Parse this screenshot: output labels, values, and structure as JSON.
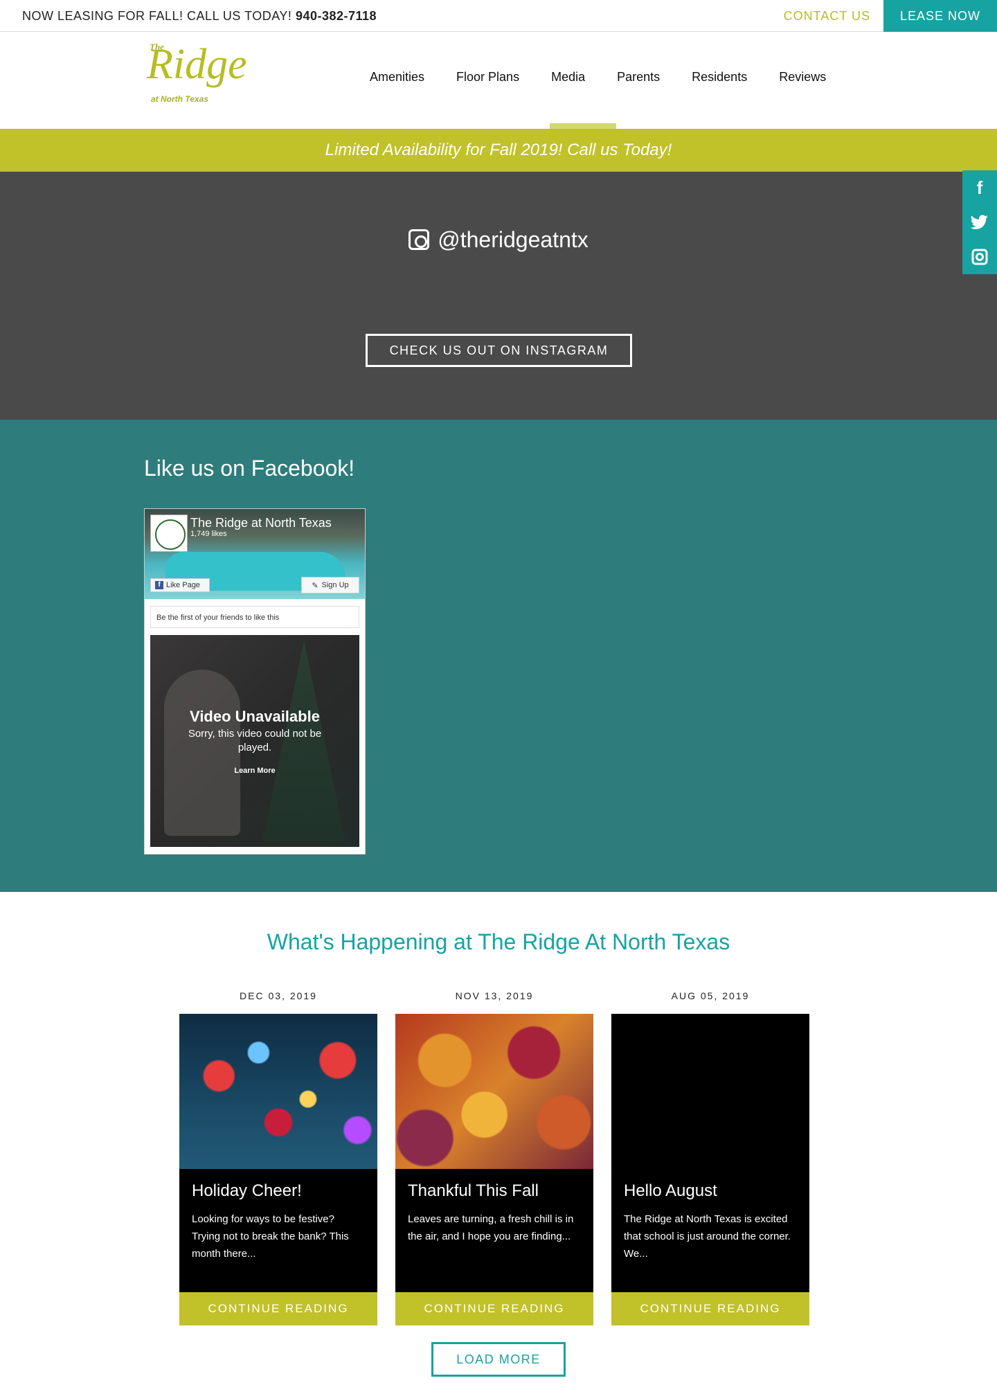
{
  "topbar": {
    "promo_text": "NOW LEASING FOR FALL! CALL US TODAY!",
    "phone": "940-382-7118",
    "contact_label": "CONTACT US",
    "lease_label": "LEASE NOW"
  },
  "logo": {
    "the": "The",
    "ridge": "Ridge",
    "sub": "at North Texas"
  },
  "nav": {
    "items": [
      "Amenities",
      "Floor Plans",
      "Media",
      "Parents",
      "Residents",
      "Reviews"
    ],
    "active": "Media"
  },
  "banner": {
    "text": "Limited Availability for Fall 2019! Call us Today!"
  },
  "instagram": {
    "handle": "@theridgeatntx",
    "cta_label": "CHECK US OUT ON INSTAGRAM"
  },
  "social": {
    "icons": [
      "facebook-icon",
      "twitter-icon",
      "instagram-icon"
    ]
  },
  "facebook": {
    "heading": "Like us on Facebook!",
    "widget": {
      "page_name": "The Ridge at North Texas",
      "likes": "1,749 likes",
      "like_label": "Like Page",
      "signup_label": "Sign Up",
      "friends_text": "Be the first of your friends to like this",
      "video_title": "Video Unavailable",
      "video_message": "Sorry, this video could not be played.",
      "learn_more": "Learn More"
    }
  },
  "news": {
    "heading": "What's Happening at The Ridge At North Texas",
    "posts": [
      {
        "date": "DEC 03, 2019",
        "title": "Holiday Cheer!",
        "excerpt": "Looking for ways to be festive? Trying not to break the bank? This month there...",
        "read_label": "CONTINUE READING"
      },
      {
        "date": "NOV 13, 2019",
        "title": "Thankful This Fall",
        "excerpt": "Leaves are turning, a fresh chill is in the air, and I hope you are finding...",
        "read_label": "CONTINUE READING"
      },
      {
        "date": "AUG 05, 2019",
        "title": "Hello August",
        "excerpt": "The Ridge at North Texas is excited that school is just around the corner. We...",
        "read_label": "CONTINUE READING"
      }
    ],
    "load_more_label": "LOAD MORE"
  },
  "colors": {
    "brand_teal": "#16a3a2",
    "brand_lime": "#c1c12a",
    "dark_section": "#4a4a4b",
    "facebook_section": "#2e7c7c"
  }
}
